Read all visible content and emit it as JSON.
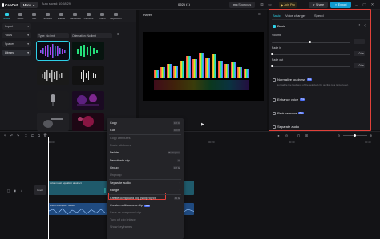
{
  "titlebar": {
    "app_name": "CapCut",
    "menu_label": "Menu",
    "autosave": "Auto saved: 10:58:29",
    "document_title": "0925 (1)",
    "shortcuts_label": "Shortcuts",
    "join_pro_label": "Join Pro",
    "share_label": "Share",
    "export_label": "Export"
  },
  "toolbar": {
    "items": [
      "Media",
      "Audio",
      "Text",
      "Stickers",
      "Effects",
      "Transitions",
      "Captions",
      "Filters",
      "Adjustmen"
    ],
    "active_index": 0
  },
  "sidenav": {
    "items": [
      "Import",
      "Yours",
      "Spaces",
      "Library"
    ],
    "selected_index": 3
  },
  "filters": {
    "type_label": "Type: No limit",
    "orientation_label": "Orientation: No limit"
  },
  "player": {
    "title": "Player"
  },
  "right_panel": {
    "tabs": [
      "Basic",
      "Voice changer",
      "Speed"
    ],
    "active_tab": 0,
    "basic_title": "Basic",
    "volume_label": "Volume",
    "fade_in_label": "Fade in",
    "fade_in_value": "0.0s",
    "fade_out_label": "Fade out",
    "fade_out_value": "0.0s",
    "normalize_label": "Normalize loudness",
    "normalize_desc": "Normalize the loudness of the selected clip or clips to a target level.",
    "enhance_label": "Enhance voice",
    "reduce_noise_label": "Reduce noise",
    "separate_label": "Separate audio",
    "pro_badge": "Pro"
  },
  "timeline": {
    "ruler": [
      "00:00",
      "00:10",
      "00:20",
      "00:30",
      "00:40"
    ],
    "cover_label": "Cover",
    "video_clip_label": "color music equalizer abstract",
    "audio_clip_label": "Prime mixing01 | NeoB"
  },
  "context_menu": {
    "items": [
      {
        "label": "Copy",
        "kbd": "Ctrl C",
        "disabled": false
      },
      {
        "label": "Cut",
        "kbd": "Ctrl X",
        "disabled": false
      },
      {
        "label": "Copy attributes",
        "kbd": "",
        "disabled": true
      },
      {
        "label": "Paste attributes",
        "kbd": "",
        "disabled": true
      },
      {
        "label": "Delete",
        "kbd": "Backspace",
        "disabled": false
      },
      {
        "label": "Deactivate clip",
        "kbd": "V",
        "disabled": false
      },
      {
        "label": "Group",
        "kbd": "Ctrl G",
        "disabled": false
      },
      {
        "label": "Ungroup",
        "kbd": "",
        "disabled": true
      },
      {
        "label": "Separate audio",
        "kbd": "",
        "disabled": false
      },
      {
        "label": "Range",
        "kbd": "",
        "disabled": false
      },
      {
        "label": "Create compound clip (subproject)",
        "kbd": "Alt G",
        "disabled": false
      },
      {
        "label": "Create multi-camera clip",
        "kbd": "",
        "disabled": false
      },
      {
        "label": "Save as compound clip",
        "kbd": "",
        "disabled": true
      },
      {
        "label": "Turn off clip linkage",
        "kbd": "",
        "disabled": true
      },
      {
        "label": "Show keyframes",
        "kbd": "",
        "disabled": true
      }
    ],
    "new_badge": "New"
  },
  "colors": {
    "accent": "#2fd1e8",
    "highlight": "#e1413a",
    "export": "#0f9bd0"
  }
}
